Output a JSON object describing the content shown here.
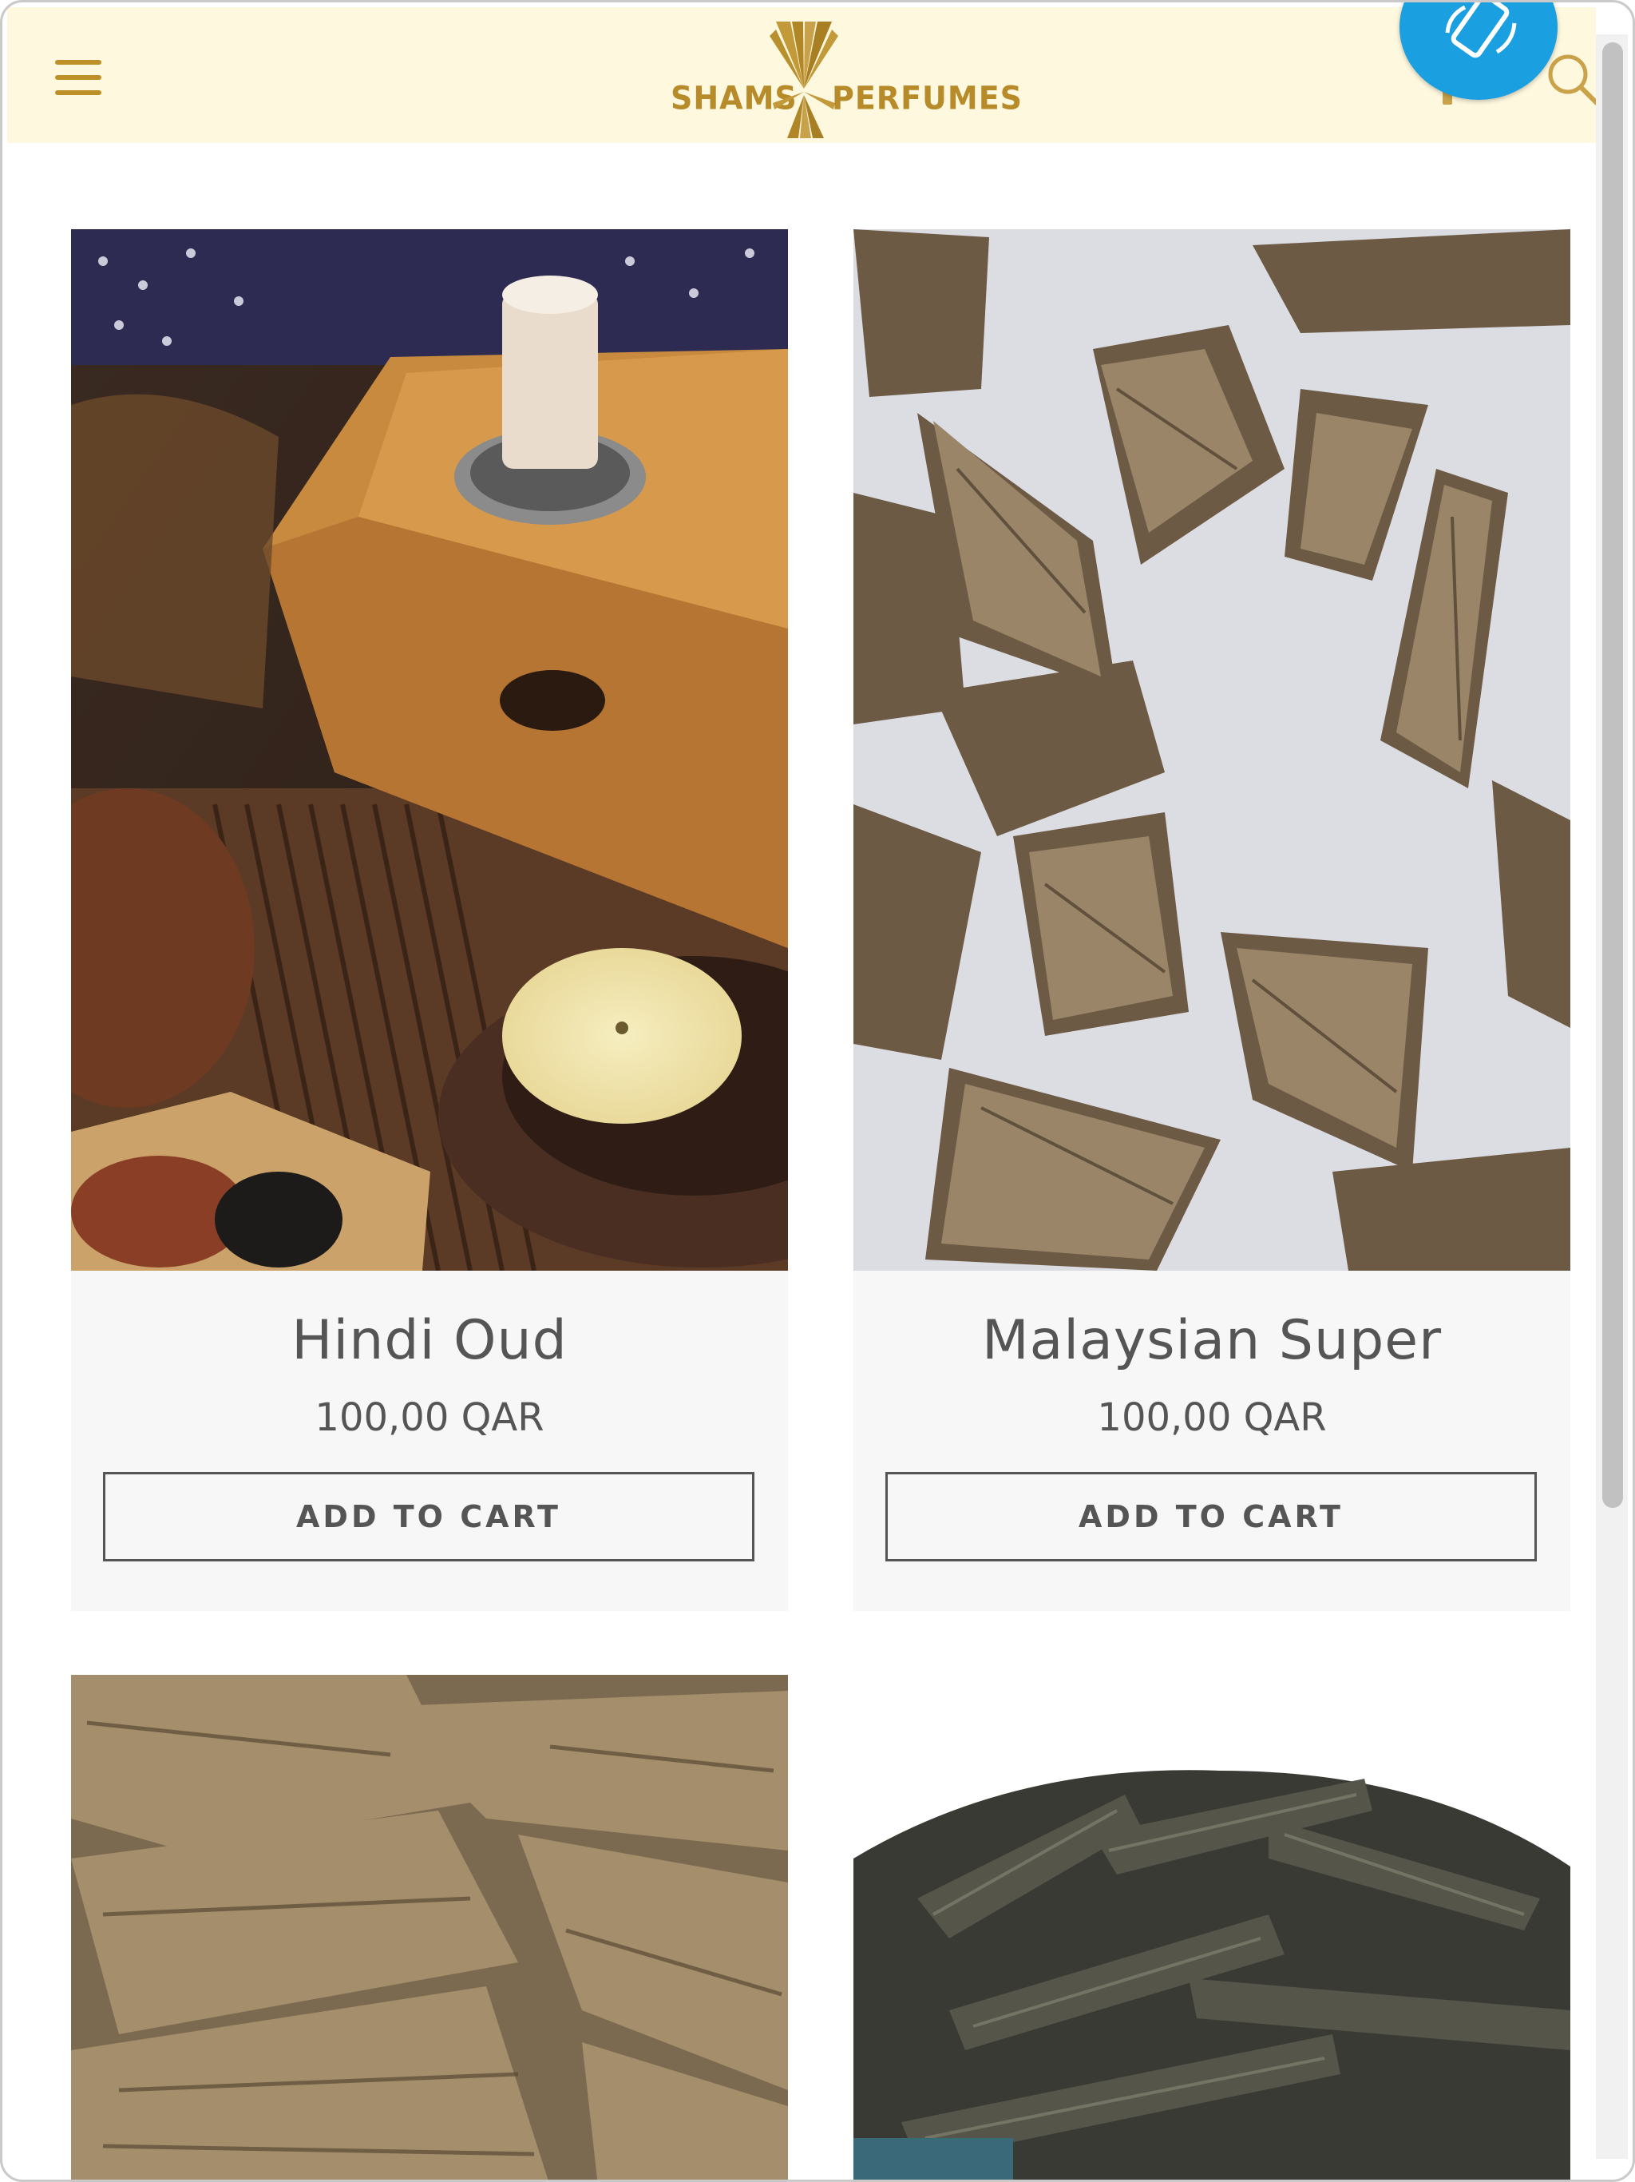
{
  "header": {
    "logo_left": "SHAMS",
    "logo_right": "PERFUMES"
  },
  "colors": {
    "header_bg": "#fef8df",
    "brand_gold": "#bd9128",
    "rotate_button": "#1a9fe0",
    "card_bg": "#f7f7f7",
    "text": "#555555"
  },
  "icons": {
    "menu": "hamburger-icon",
    "search": "search-icon",
    "rotate": "screen-rotate-icon"
  },
  "products": [
    {
      "name": "Hindi Oud",
      "price": "100,00 QAR",
      "button": "ADD TO CART"
    },
    {
      "name": "Malaysian Super",
      "price": "100,00 QAR",
      "button": "ADD TO CART"
    },
    {
      "name": "",
      "price": "",
      "button": ""
    },
    {
      "name": "",
      "price": "",
      "button": ""
    }
  ]
}
